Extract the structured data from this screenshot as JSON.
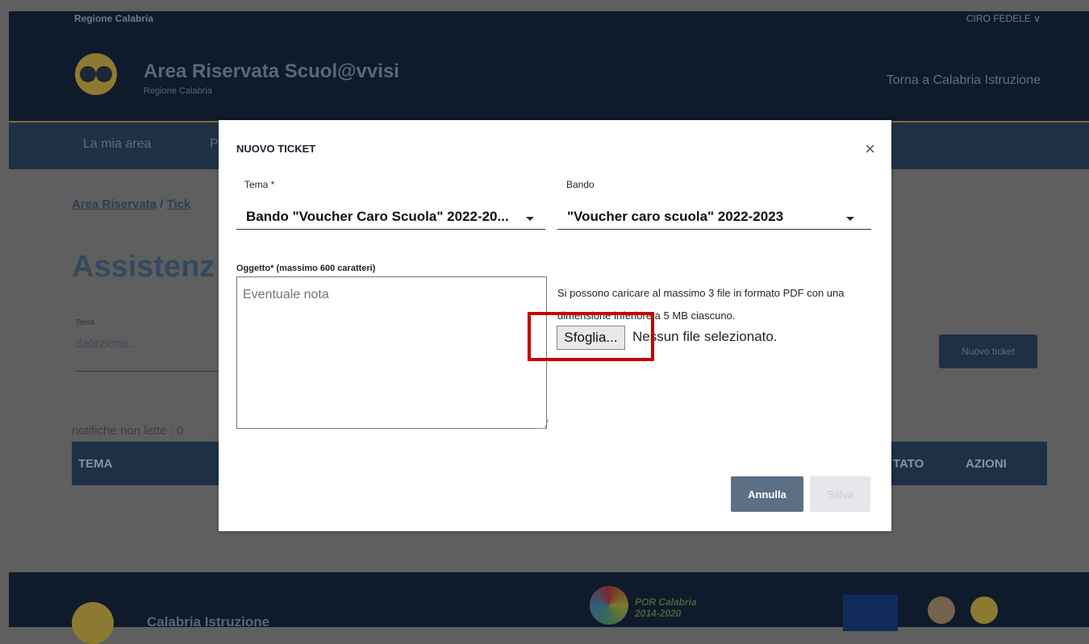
{
  "header": {
    "region_name": "Regione Calabria",
    "user_menu": "CIRO FEDELE ∨",
    "site_title": "Area Riservata Scuol@vvisi",
    "site_subtitle": "Regione Calabria",
    "back_link": "Torna a Calabria Istruzione"
  },
  "nav": {
    "items": [
      {
        "label": "La mia area"
      },
      {
        "label": "P"
      }
    ]
  },
  "content": {
    "breadcrumb": {
      "first": "Area Riservata",
      "separator": "/",
      "second": "Tick"
    },
    "page_title": "Assistenz",
    "filter": {
      "label": "Tema",
      "value": "Seleziona..."
    },
    "new_ticket_button": "Nuovo ticket",
    "unread": "notifiche non lette : 0",
    "table_headers": [
      "TEMA",
      "TATO",
      "AZIONI"
    ]
  },
  "footer": {
    "title": "Calabria Istruzione",
    "por_text_1": "POR Calabria",
    "por_text_2": "2014-2020"
  },
  "modal": {
    "title": "NUOVO TICKET",
    "close": "×",
    "tema": {
      "label": "Tema *",
      "value": "Bando \"Voucher Caro Scuola\" 2022-20..."
    },
    "bando": {
      "label": "Bando",
      "value": "\"Voucher caro scuola\" 2022-2023"
    },
    "oggetto": {
      "label": "Oggetto* (massimo 600 caratteri)",
      "placeholder": "Eventuale nota"
    },
    "upload": {
      "info": "Si possono caricare al massimo 3 file in formato PDF con una dimensione inferiore a 5 MB ciascuno.",
      "button": "Sfoglia...",
      "status": "Nessun file selezionato."
    },
    "buttons": {
      "cancel": "Annulla",
      "save": "Salva"
    }
  },
  "colors": {
    "header_bg": "#0f1a2b",
    "nav_bg": "#1f3145",
    "highlight": "#c60000"
  }
}
